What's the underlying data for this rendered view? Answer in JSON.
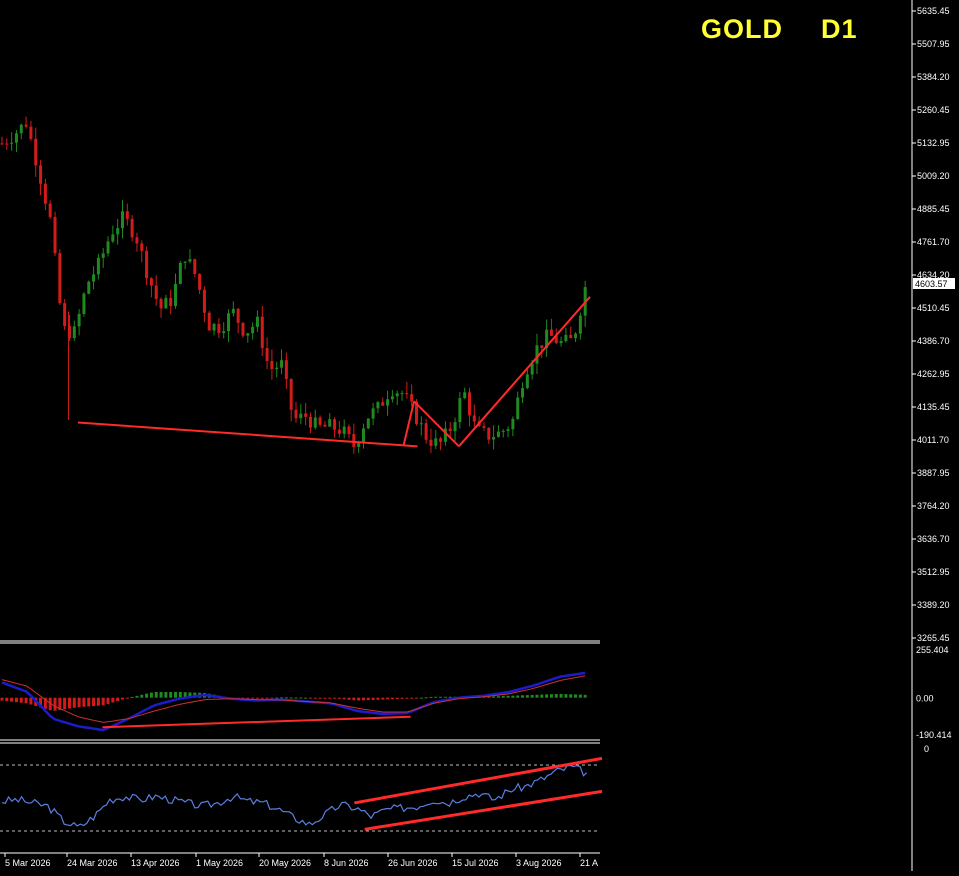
{
  "chart_data": {
    "type": "candlestick",
    "symbol": "GOLD",
    "timeframe": "D1",
    "colors": {
      "background": "#000000",
      "bull_candle": "#1f8a1f",
      "bear_candle": "#d21c1c",
      "trendline": "#ff2a2a",
      "axis_text": "#ffffff",
      "title": "#ffff33",
      "macd_fast": "#1c1cc8",
      "macd_signal": "#cc3030",
      "macd_hist_pos": "#1f8a1f",
      "macd_hist_neg": "#d21c1c",
      "rsi_line": "#5a7fe0"
    },
    "price_axis": {
      "labels": [
        "5635.45",
        "5507.95",
        "5384.20",
        "5260.45",
        "5132.95",
        "5009.20",
        "4885.45",
        "4761.70",
        "4634.20",
        "4510.45",
        "4386.70",
        "4262.95",
        "4135.45",
        "4011.70",
        "3887.95",
        "3764.20",
        "3636.70",
        "3512.95",
        "3389.20",
        "3265.45"
      ],
      "ylim": [
        3265.45,
        5635.45
      ],
      "current_price": "4603.57"
    },
    "date_axis": [
      "5 Mar 2026",
      "24 Mar 2026",
      "13 Apr 2026",
      "1 May 2026",
      "20 May 2026",
      "8 Jun 2026",
      "26 Jun 2026",
      "15 Jul 2026",
      "3 Aug 2026",
      "21 A"
    ],
    "price_path": [
      5135,
      5170,
      5215,
      5040,
      4840,
      4430,
      4420,
      4605,
      4680,
      4800,
      4855,
      4790,
      4640,
      4510,
      4545,
      4720,
      4630,
      4450,
      4440,
      4500,
      4420,
      4460,
      4280,
      4300,
      4090,
      4105,
      4060,
      4065,
      4050,
      3990,
      4100,
      4135,
      4210,
      4190,
      4110,
      4020,
      3995,
      4065,
      4200,
      4050,
      4030,
      4040,
      4080,
      4270,
      4360,
      4410,
      4380,
      4390,
      4590
    ],
    "price_trendlines": [
      {
        "from": [
          "3 Mar 2026",
          4080
        ],
        "to": [
          "2 Jul 2026",
          3990
        ]
      },
      {
        "from": [
          "28 Jun 2026",
          3995
        ],
        "to": [
          "1 Jul 2026",
          4160
        ]
      },
      {
        "from": [
          "1 Jul 2026",
          4160
        ],
        "to": [
          "14 Jul 2026",
          3990
        ]
      },
      {
        "from": [
          "14 Jul 2026",
          3990
        ],
        "to": [
          "21 Aug 2026",
          4555
        ]
      }
    ],
    "macd": {
      "axis_labels": [
        "255.404",
        "0.00",
        "-190.414"
      ],
      "ylim": [
        -190.414,
        255.404
      ],
      "fast": [
        80,
        30,
        -110,
        -150,
        -170,
        -110,
        -40,
        -5,
        15,
        -5,
        -15,
        -10,
        -20,
        -30,
        -70,
        -85,
        -80,
        -25,
        0,
        10,
        30,
        65,
        110,
        130
      ],
      "signal": [
        95,
        60,
        -40,
        -100,
        -130,
        -110,
        -70,
        -35,
        -10,
        -5,
        -10,
        -12,
        -20,
        -28,
        -55,
        -75,
        -75,
        -30,
        -5,
        5,
        20,
        50,
        90,
        115
      ],
      "histogram": [
        -15,
        -30,
        -70,
        -50,
        -40,
        0,
        30,
        30,
        25,
        0,
        -5,
        2,
        0,
        -2,
        -15,
        -10,
        -5,
        5,
        5,
        5,
        10,
        15,
        20,
        15
      ],
      "trendline": {
        "from": [
          "24 Mar 2026",
          -155
        ],
        "to": [
          "30 Jun 2026",
          -100
        ]
      }
    },
    "rsi": {
      "axis_labels": [
        "0"
      ],
      "levels": [
        70,
        30
      ],
      "values": [
        48,
        49,
        47,
        45,
        36,
        32,
        39,
        49,
        51,
        49,
        51,
        49,
        47,
        45,
        47,
        51,
        48,
        47,
        43,
        38,
        34,
        40,
        46,
        44,
        39,
        43,
        44,
        45,
        49,
        47,
        51,
        53,
        49,
        55,
        57,
        61,
        66,
        69,
        65
      ],
      "trendlines": [
        {
          "from": [
            "5 Jun 2026",
            47
          ],
          "to": [
            "21 Aug 2026",
            74
          ]
        },
        {
          "from": [
            "8 Jun 2026",
            31
          ],
          "to": [
            "21 Aug 2026",
            54
          ]
        }
      ]
    }
  },
  "title": {
    "symbol": "GOLD",
    "timeframe": "D1"
  }
}
